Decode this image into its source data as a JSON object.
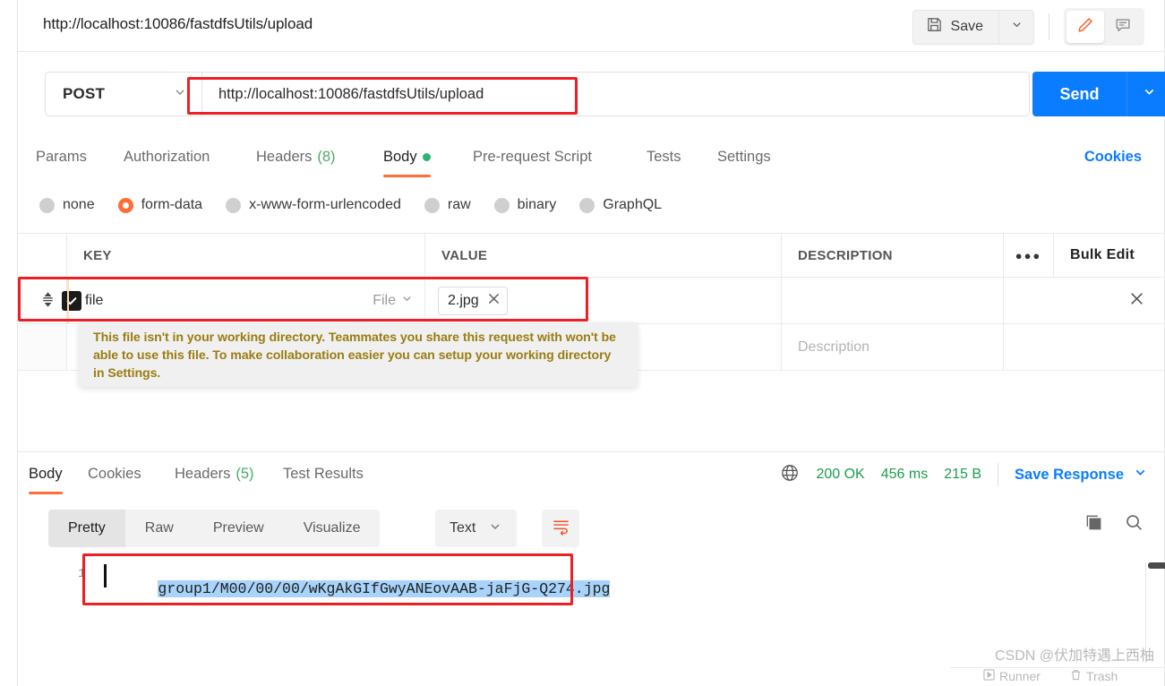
{
  "header": {
    "request_title": "http://localhost:10086/fastdfsUtils/upload",
    "save_label": "Save",
    "save_icon": "floppy-disk-icon",
    "save_caret_icon": "chevron-down-icon",
    "edit_icon": "pencil-icon",
    "comment_icon": "comment-icon",
    "accent_orange": "#ff6c37"
  },
  "url_bar": {
    "method": "POST",
    "method_caret_icon": "chevron-down-icon",
    "url": "http://localhost:10086/fastdfsUtils/upload",
    "send_label": "Send",
    "send_caret_icon": "chevron-down-icon",
    "send_color": "#0a7cff"
  },
  "request_tabs": {
    "items": [
      {
        "label": "Params",
        "active": false
      },
      {
        "label": "Authorization",
        "active": false
      },
      {
        "label": "Headers",
        "count": "(8)",
        "active": false
      },
      {
        "label": "Body",
        "active": true,
        "dot": true
      },
      {
        "label": "Pre-request Script",
        "active": false
      },
      {
        "label": "Tests",
        "active": false
      },
      {
        "label": "Settings",
        "active": false
      }
    ],
    "cookies_label": "Cookies"
  },
  "body_types": [
    {
      "label": "none",
      "selected": false
    },
    {
      "label": "form-data",
      "selected": true
    },
    {
      "label": "x-www-form-urlencoded",
      "selected": false
    },
    {
      "label": "raw",
      "selected": false
    },
    {
      "label": "binary",
      "selected": false
    },
    {
      "label": "GraphQL",
      "selected": false
    }
  ],
  "kv_table": {
    "headers": {
      "key": "KEY",
      "value": "VALUE",
      "description": "DESCRIPTION",
      "more_icon": "ellipsis-icon",
      "bulk_edit": "Bulk Edit"
    },
    "rows": [
      {
        "checked": true,
        "key": "file",
        "type": "File",
        "type_caret_icon": "chevron-down-icon",
        "file_chip": "2.jpg",
        "chip_remove_icon": "close-icon",
        "row_remove_icon": "close-icon"
      },
      {
        "checked": false,
        "key": "",
        "value": "",
        "description_placeholder": "Description"
      }
    ]
  },
  "warning_tooltip": {
    "text": "This file isn't in your working directory. Teammates you share this request with won't be able to use this file. To make collaboration easier you can setup your working directory in Settings.",
    "color": "#9a7d12"
  },
  "response_tabs": {
    "items": [
      {
        "label": "Body",
        "active": true
      },
      {
        "label": "Cookies",
        "active": false
      },
      {
        "label": "Headers",
        "count": "(5)",
        "active": false
      },
      {
        "label": "Test Results",
        "active": false
      }
    ],
    "globe_icon": "globe-icon",
    "status": "200 OK",
    "time": "456 ms",
    "size": "215 B",
    "save_response_label": "Save Response",
    "save_response_caret_icon": "chevron-down-icon",
    "status_color": "#1a9e4b"
  },
  "format_bar": {
    "segments": [
      {
        "label": "Pretty",
        "active": true
      },
      {
        "label": "Raw",
        "active": false
      },
      {
        "label": "Preview",
        "active": false
      },
      {
        "label": "Visualize",
        "active": false
      }
    ],
    "format": "Text",
    "format_caret_icon": "chevron-down-icon",
    "wrap_icon": "wrap-lines-icon",
    "copy_icon": "copy-icon",
    "search_icon": "search-icon"
  },
  "response_body": {
    "line_number": "1",
    "content": "group1/M00/00/00/wKgAkGIfGwyANEovAAB-jaFjG-Q274.jpg",
    "selected": true
  },
  "watermark": {
    "text": "CSDN @伏加特遇上西柚",
    "footer_runner": "Runner",
    "footer_trash": "Trash"
  }
}
